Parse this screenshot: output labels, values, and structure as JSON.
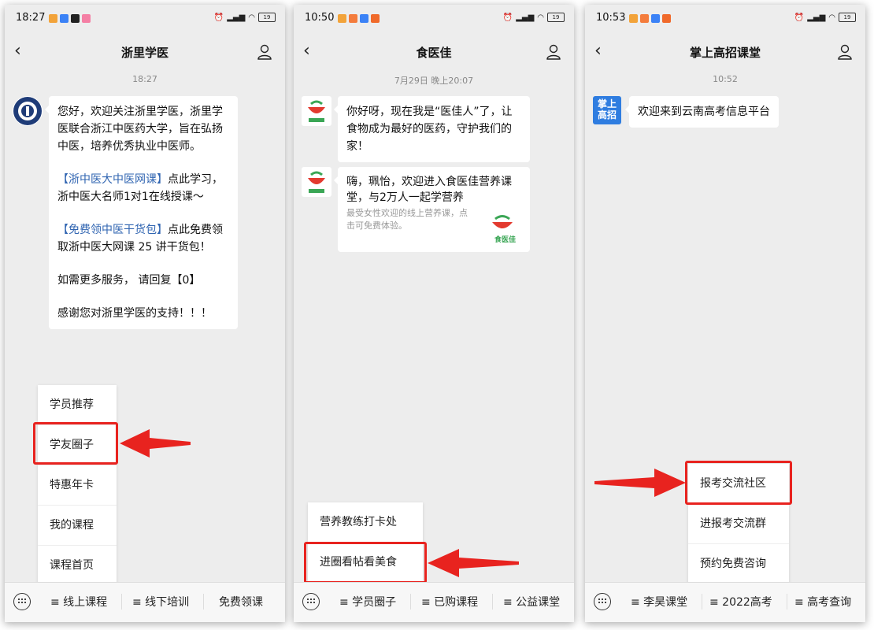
{
  "screens": [
    {
      "status_time": "18:27",
      "title": "浙里学医",
      "timestamp": "18:27",
      "message": {
        "p1": "您好，欢迎关注浙里学医，浙里学医联合浙江中医药大学，旨在弘扬中医，培养优秀执业中医师。",
        "p2_link": "【浙中医大中医网课】",
        "p2_text": "点此学习，浙中医大名师1对1在线授课～",
        "p3_link": "【免费领中医干货包】",
        "p3_text": "点此免费领取浙中医大网课 25 讲干货包！",
        "p4": "如需更多服务， 请回复【0】",
        "p5": "感谢您对浙里学医的支持！！！"
      },
      "popup_items": [
        "学员推荐",
        "学友圈子",
        "特惠年卡",
        "我的课程",
        "课程首页"
      ],
      "highlighted_item": "学友圈子",
      "bottom_menu": [
        "≡ 线上课程",
        "≡ 线下培训",
        "免费领课"
      ]
    },
    {
      "status_time": "10:50",
      "title": "食医佳",
      "timestamp": "7月29日 晚上20:07",
      "message1": "你好呀，现在我是“医佳人”了，让食物成为最好的医药，守护我们的家！",
      "message2_title": "嗨，珮怡，欢迎进入食医佳营养课堂，与2万人一起学营养",
      "message2_desc": "最受女性欢迎的线上营养课，点击可免费体验。",
      "brand_logo": "食医佳",
      "popup_items": [
        "营养教练打卡处",
        "进圈看帖看美食"
      ],
      "highlighted_item": "进圈看帖看美食",
      "bottom_menu": [
        "≡ 学员圈子",
        "≡ 已购课程",
        "≡ 公益课堂"
      ]
    },
    {
      "status_time": "10:53",
      "title": "掌上高招课堂",
      "timestamp": "10:52",
      "avatar_text": "掌上高招",
      "message": "欢迎来到云南高考信息平台",
      "popup_items": [
        "报考交流社区",
        "进报考交流群",
        "预约免费咨询"
      ],
      "highlighted_item": "报考交流社区",
      "bottom_menu": [
        "≡ 李昊课堂",
        "≡ 2022高考",
        "≡ 高考查询"
      ]
    }
  ],
  "colors": {
    "highlight": "#e8231f",
    "link": "#2f64b1",
    "background": "#ededed"
  },
  "icons": [
    "back-chevron-icon",
    "user-profile-icon",
    "keyboard-icon",
    "red-arrow-icon",
    "wifi-icon",
    "signal-icon",
    "battery-icon",
    "alarm-icon"
  ]
}
